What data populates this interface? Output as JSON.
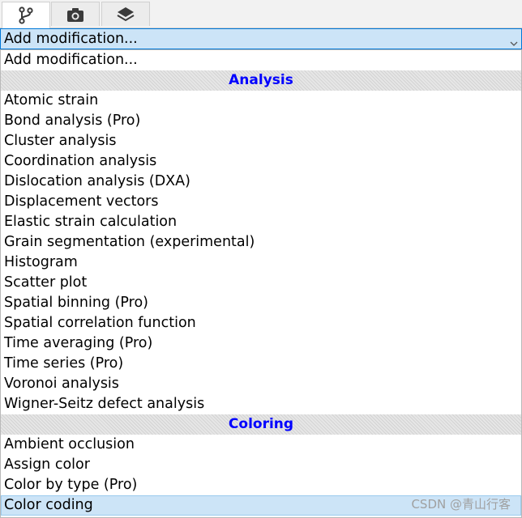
{
  "tabs": [
    {
      "icon": "pipeline-icon",
      "active": true
    },
    {
      "icon": "camera-icon",
      "active": false
    },
    {
      "icon": "layers-icon",
      "active": false
    }
  ],
  "combo": {
    "value": "Add modification..."
  },
  "dropdown": {
    "first_item": "Add modification...",
    "sections": [
      {
        "header": "Analysis",
        "items": [
          "Atomic strain",
          "Bond analysis (Pro)",
          "Cluster analysis",
          "Coordination analysis",
          "Dislocation analysis (DXA)",
          "Displacement vectors",
          "Elastic strain calculation",
          "Grain segmentation (experimental)",
          "Histogram",
          "Scatter plot",
          "Spatial binning (Pro)",
          "Spatial correlation function",
          "Time averaging (Pro)",
          "Time series (Pro)",
          "Voronoi analysis",
          "Wigner-Seitz defect analysis"
        ]
      },
      {
        "header": "Coloring",
        "items": [
          "Ambient occlusion",
          "Assign color",
          "Color by type (Pro)",
          "Color coding"
        ]
      }
    ],
    "selected_item": "Color coding"
  },
  "watermark": "CSDN @青山行客",
  "colors": {
    "header_text": "#0000ff",
    "highlight": "#cce4f7"
  }
}
